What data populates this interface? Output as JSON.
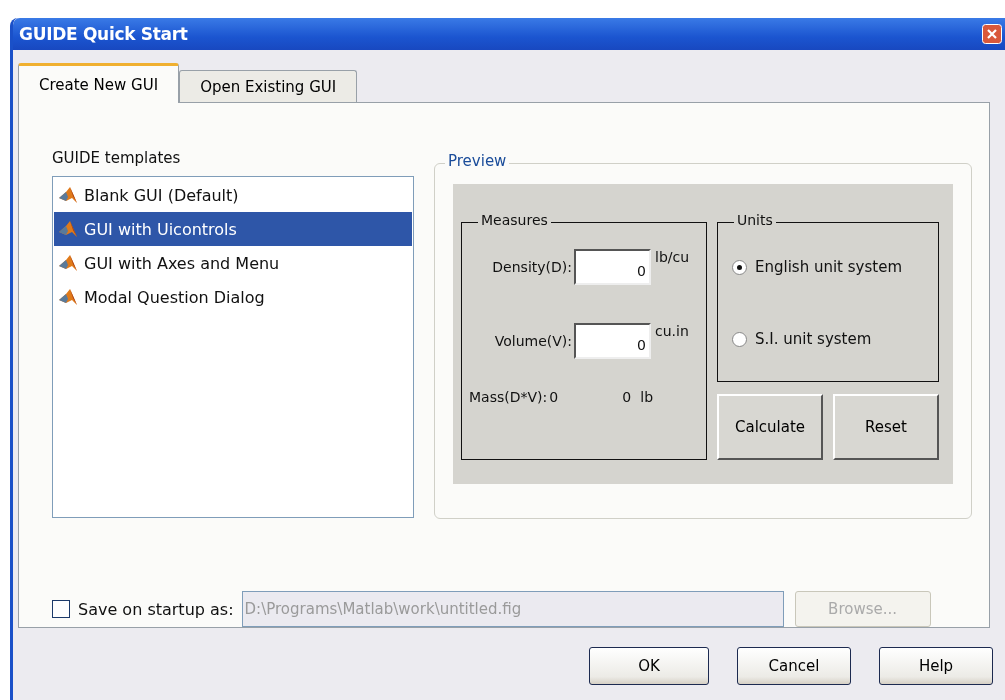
{
  "window": {
    "title": "GUIDE Quick Start"
  },
  "tabs": [
    {
      "label": "Create New GUI",
      "selected": true
    },
    {
      "label": "Open Existing GUI",
      "selected": false
    }
  ],
  "templates": {
    "label": "GUIDE templates",
    "items": [
      {
        "label": "Blank GUI (Default)",
        "selected": false
      },
      {
        "label": "GUI with Uicontrols",
        "selected": true
      },
      {
        "label": "GUI with Axes and Menu",
        "selected": false
      },
      {
        "label": "Modal Question Dialog",
        "selected": false
      }
    ]
  },
  "preview": {
    "title": "Preview",
    "measures": {
      "title": "Measures",
      "fields": [
        {
          "label": "Density(D):",
          "value": "0",
          "unit": "lb/cu"
        },
        {
          "label": "Volume(V):",
          "value": "0",
          "unit": "cu.in"
        }
      ],
      "mass": {
        "label": "Mass(D*V):",
        "value": "0",
        "result": "0",
        "unit": "lb"
      }
    },
    "units": {
      "title": "Units",
      "options": [
        {
          "label": "English unit system",
          "selected": true
        },
        {
          "label": "S.I. unit system",
          "selected": false
        }
      ]
    },
    "buttons": [
      "Calculate",
      "Reset"
    ]
  },
  "save": {
    "checked": false,
    "label": "Save on startup as:",
    "value": "D:\\Programs\\Matlab\\work\\untitled.fig",
    "disabled": true,
    "browse": "Browse..."
  },
  "buttons": [
    "OK",
    "Cancel",
    "Help"
  ]
}
